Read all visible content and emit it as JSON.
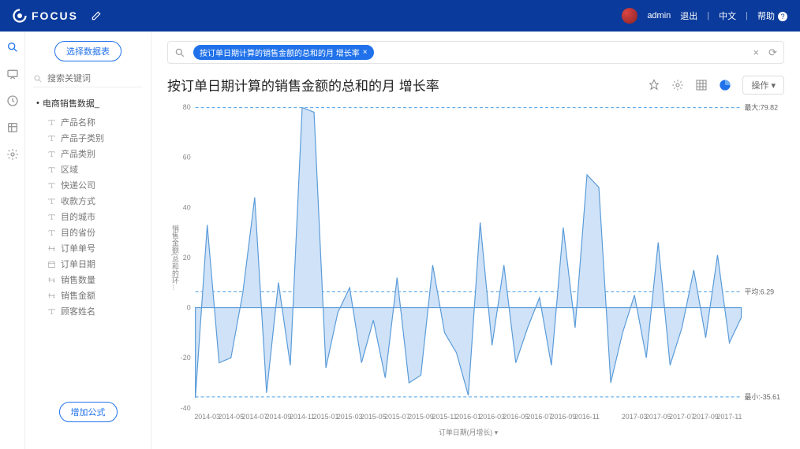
{
  "header": {
    "brand": "FOCUS",
    "user": "admin",
    "logout": "退出",
    "lang": "中文",
    "help": "帮助"
  },
  "sidebar": {
    "select_btn": "选择数据表",
    "search_placeholder": "搜索关键词",
    "root": "电商销售数据_",
    "fields": [
      {
        "icon": "text",
        "label": "产品名称"
      },
      {
        "icon": "text",
        "label": "产品子类别"
      },
      {
        "icon": "text",
        "label": "产品类别"
      },
      {
        "icon": "text",
        "label": "区域"
      },
      {
        "icon": "text",
        "label": "快递公司"
      },
      {
        "icon": "text",
        "label": "收款方式"
      },
      {
        "icon": "text",
        "label": "目的城市"
      },
      {
        "icon": "text",
        "label": "目的省份"
      },
      {
        "icon": "num",
        "label": "订单单号"
      },
      {
        "icon": "date",
        "label": "订单日期"
      },
      {
        "icon": "num",
        "label": "销售数量"
      },
      {
        "icon": "num",
        "label": "销售金额"
      },
      {
        "icon": "text",
        "label": "顾客姓名"
      }
    ],
    "add_formula": "增加公式"
  },
  "query": {
    "chip": "按订单日期计算的销售金额的总和的月 增长率"
  },
  "main": {
    "title": "按订单日期计算的销售金额的总和的月 增长率",
    "operate": "操作",
    "xlabel": "订单日期(月增长)",
    "ylabel": "销售金额(总和的环...",
    "max_label": "最大:79.82",
    "avg_label": "平均:6.29",
    "min_label": "最小:-35.61"
  },
  "chart_data": {
    "type": "area",
    "title": "按订单日期计算的销售金额的总和的月 增长率",
    "xlabel": "订单日期(月增长)",
    "ylabel": "销售金额(总和的环比增长率)",
    "ylim": [
      -40,
      80
    ],
    "ref_lines": {
      "max": 79.82,
      "avg": 6.29,
      "min": -35.61
    },
    "categories": [
      "2014-03",
      "2014-05",
      "2014-07",
      "2014-09",
      "2014-11",
      "2015-01",
      "2015-03",
      "2015-05",
      "2015-07",
      "2015-09",
      "2015-11",
      "2016-01",
      "2016-03",
      "2016-05",
      "2016-07",
      "2016-09",
      "2016-11",
      "2017-03",
      "2017-05",
      "2017-07",
      "2017-09",
      "2017-11"
    ],
    "series": [
      {
        "name": "增长率",
        "x_dense": [
          "2014-02",
          "2014-03",
          "2014-04",
          "2014-05",
          "2014-06",
          "2014-07",
          "2014-08",
          "2014-09",
          "2014-10",
          "2014-11",
          "2014-12",
          "2015-01",
          "2015-02",
          "2015-03",
          "2015-04",
          "2015-05",
          "2015-06",
          "2015-07",
          "2015-08",
          "2015-09",
          "2015-10",
          "2015-11",
          "2015-12",
          "2016-01",
          "2016-02",
          "2016-03",
          "2016-04",
          "2016-05",
          "2016-06",
          "2016-07",
          "2016-08",
          "2016-09",
          "2016-10",
          "2016-11",
          "2016-12",
          "2017-01",
          "2017-02",
          "2017-03",
          "2017-04",
          "2017-05",
          "2017-06",
          "2017-07",
          "2017-08",
          "2017-09",
          "2017-10",
          "2017-11",
          "2017-12"
        ],
        "values": [
          -36,
          33,
          -22,
          -20,
          6,
          44,
          -34,
          10,
          -23,
          79.82,
          78,
          -24,
          -2,
          8,
          -22,
          -5,
          -28,
          12,
          -30,
          -27,
          17,
          -10,
          -18,
          -35,
          34,
          -15,
          17,
          -22,
          -8,
          4,
          -23,
          32,
          -8,
          53,
          48,
          -30,
          -10,
          5,
          -20,
          26,
          -23,
          -8,
          15,
          -12,
          21,
          -14,
          -4
        ]
      }
    ]
  }
}
